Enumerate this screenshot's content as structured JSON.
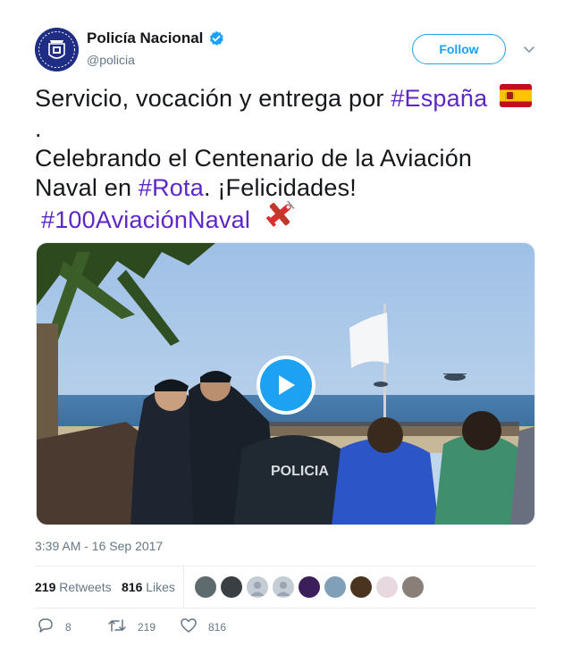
{
  "account": {
    "name": "Policía Nacional",
    "handle": "@policia",
    "follow_label": "Follow"
  },
  "tweet": {
    "line1_text": "Servicio, vocación y entrega por ",
    "line1_hashtag": "#España",
    "line2_text": ".",
    "line3_text": "Celebrando el Centenario de la Aviación",
    "line4_text": "Naval en ",
    "line4_hashtag": "#Rota",
    "line4_suffix": ". ¡Felicidades!",
    "line5_hashtag": "#100AviaciónNaval"
  },
  "media": {
    "type": "video",
    "play_icon": "play-icon",
    "background_text": "POLICIA"
  },
  "timestamp": "3:39 AM - 16 Sep 2017",
  "stats": {
    "retweets_count": "219",
    "retweets_label": "Retweets",
    "likes_count": "816",
    "likes_label": "Likes"
  },
  "actions": {
    "reply_count": "8",
    "retweet_count": "219",
    "like_count": "816"
  },
  "colors": {
    "accent": "#1da1f2",
    "hashtag": "#5d27c8",
    "secondary_text": "#657786",
    "divider": "#e6ecf0"
  }
}
